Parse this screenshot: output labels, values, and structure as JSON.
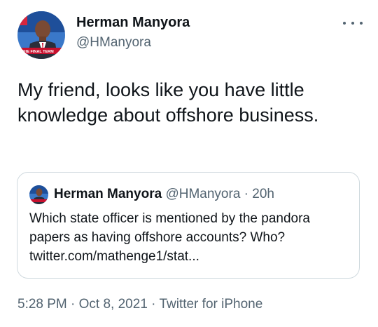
{
  "author": {
    "name": "Herman Manyora",
    "handle": "@HManyora",
    "avatar_banner_text": "THE FINAL TERM"
  },
  "menu": {
    "icon": "more-horizontal-icon"
  },
  "tweet": {
    "text": "My friend, looks like you have little knowledge about offshore business."
  },
  "quoted_tweet": {
    "name": "Herman Manyora",
    "handle": "@HManyora",
    "separator": " · ",
    "time": "20h",
    "text_line1": "Which state officer is mentioned by the pandora",
    "text_line2": "papers as having offshore accounts? Who?",
    "text_line3": "twitter.com/mathenge1/stat..."
  },
  "footer": {
    "time": "5:28 PM",
    "sep1": " · ",
    "date": "Oct 8, 2021",
    "sep2": " · ",
    "source": "Twitter for iPhone"
  },
  "colors": {
    "text_primary": "#0f1419",
    "text_secondary": "#536471",
    "border": "#cfd9de",
    "avatar_background": "#2a64b8",
    "banner_red": "#c8102e"
  }
}
